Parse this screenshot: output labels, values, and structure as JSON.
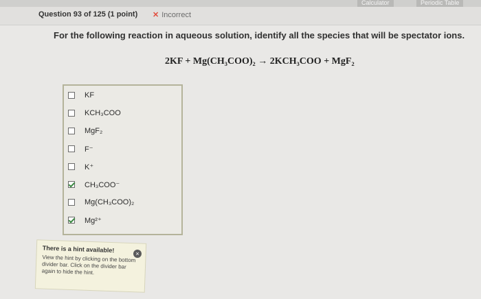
{
  "toolbar": {
    "calculator_label": "Calculator",
    "periodic_table_label": "Periodic Table"
  },
  "header": {
    "question_number": "Question 93 of 125 (1 point)",
    "status": "Incorrect"
  },
  "question": {
    "prompt": "For the following reaction in aqueous solution, identify all the species that will be spectator ions.",
    "equation": "2KF + Mg(CH₃COO)₂  →  2KCH₃COO + MgF₂"
  },
  "options": [
    {
      "label": "KF",
      "checked": false
    },
    {
      "label": "KCH₃COO",
      "checked": false
    },
    {
      "label": "MgF₂",
      "checked": false
    },
    {
      "label": "F⁻",
      "checked": false
    },
    {
      "label": "K⁺",
      "checked": false
    },
    {
      "label": "CH₃COO⁻",
      "checked": true
    },
    {
      "label": "Mg(CH₃COO)₂",
      "checked": false
    },
    {
      "label": "Mg²⁺",
      "checked": true
    }
  ],
  "hint": {
    "title": "There is a hint available!",
    "body": "View the hint by clicking on the bottom divider bar. Click on the divider bar again to hide the hint.",
    "close_glyph": "×"
  },
  "colors": {
    "incorrect": "#e24b3b",
    "check": "#3e8a44",
    "answer_border": "#b4b39a"
  }
}
